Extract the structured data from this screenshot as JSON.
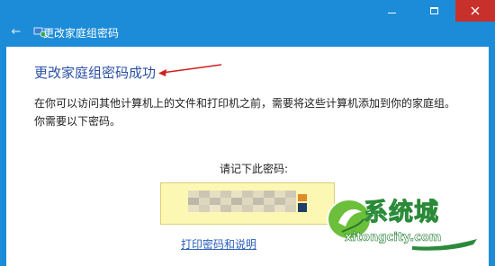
{
  "window": {
    "title": "更改家庭组密码",
    "controls": {
      "minimize": "minimize",
      "maximize": "maximize",
      "close": "close"
    }
  },
  "main": {
    "heading": "更改家庭组密码成功",
    "description": "在你可以访问其他计算机上的文件和打印机之前，需要将这些计算机添加到你的家庭组。你需要以下密码。",
    "remember_label": "请记下此密码:",
    "password_obscured": true,
    "print_link": "打印密码和说明"
  },
  "watermark": {
    "main_text": "系统城",
    "sub_text": "xitongcity.com"
  },
  "colors": {
    "titlebar": "#1c8cd8",
    "close_button": "#c7302b",
    "heading": "#2b4fa3",
    "link": "#2b5fb9",
    "password_box": "#fdf7b4",
    "annotation_arrow": "#d11f1f"
  }
}
